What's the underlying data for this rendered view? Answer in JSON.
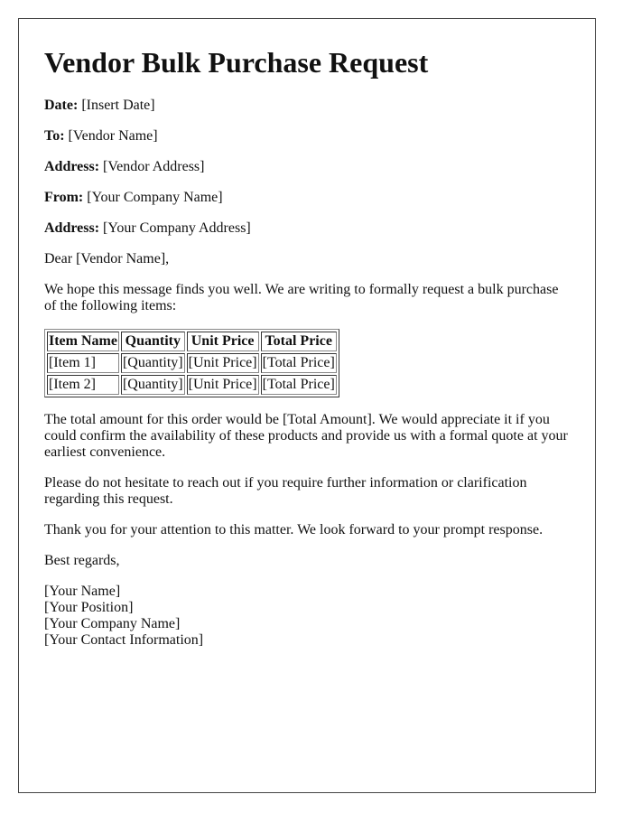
{
  "title": "Vendor Bulk Purchase Request",
  "header_fields": [
    {
      "label": "Date:",
      "value": "[Insert Date]"
    },
    {
      "label": "To:",
      "value": "[Vendor Name]"
    },
    {
      "label": "Address:",
      "value": "[Vendor Address]"
    },
    {
      "label": "From:",
      "value": "[Your Company Name]"
    },
    {
      "label": "Address:",
      "value": "[Your Company Address]"
    }
  ],
  "salutation": "Dear [Vendor Name],",
  "intro": "We hope this message finds you well. We are writing to formally request a bulk purchase of the following items:",
  "table": {
    "headers": [
      "Item Name",
      "Quantity",
      "Unit Price",
      "Total Price"
    ],
    "rows": [
      [
        "[Item 1]",
        "[Quantity]",
        "[Unit Price]",
        "[Total Price]"
      ],
      [
        "[Item 2]",
        "[Quantity]",
        "[Unit Price]",
        "[Total Price]"
      ]
    ]
  },
  "paragraphs": [
    "The total amount for this order would be [Total Amount]. We would appreciate it if you could confirm the availability of these products and provide us with a formal quote at your earliest convenience.",
    "Please do not hesitate to reach out if you require further information or clarification regarding this request.",
    "Thank you for your attention to this matter. We look forward to your prompt response."
  ],
  "closing": "Best regards,",
  "signature": [
    "[Your Name]",
    "[Your Position]",
    "[Your Company Name]",
    "[Your Contact Information]"
  ]
}
